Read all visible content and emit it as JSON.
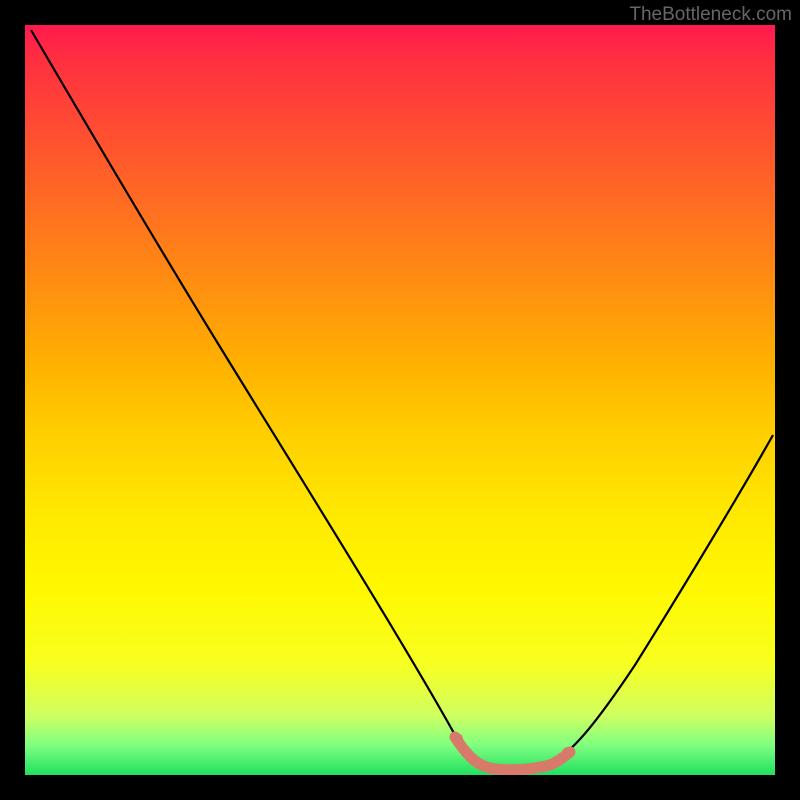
{
  "watermark": "TheBottleneck.com",
  "chart_data": {
    "type": "line",
    "title": "",
    "xlabel": "",
    "ylabel": "",
    "x_range": [
      0,
      100
    ],
    "y_range": [
      0,
      100
    ],
    "background_gradient": {
      "top": "#ff1a4d",
      "middle": "#ffe800",
      "bottom": "#20e060"
    },
    "series": [
      {
        "name": "curve",
        "color": "#000000",
        "x": [
          0,
          5,
          10,
          15,
          20,
          25,
          30,
          35,
          40,
          45,
          50,
          55,
          58,
          60,
          62,
          65,
          68,
          70,
          75,
          80,
          85,
          90,
          95,
          100
        ],
        "y": [
          100,
          94,
          86,
          78,
          70,
          62,
          54,
          46,
          38,
          30,
          22,
          14,
          8,
          4,
          2,
          1,
          1,
          2,
          6,
          12,
          20,
          30,
          41,
          53
        ]
      },
      {
        "name": "highlight",
        "color": "#d87a6a",
        "x": [
          58,
          60,
          62,
          64,
          66,
          68,
          70
        ],
        "y": [
          3,
          2,
          1.5,
          1.3,
          1.5,
          2,
          3
        ]
      }
    ]
  }
}
